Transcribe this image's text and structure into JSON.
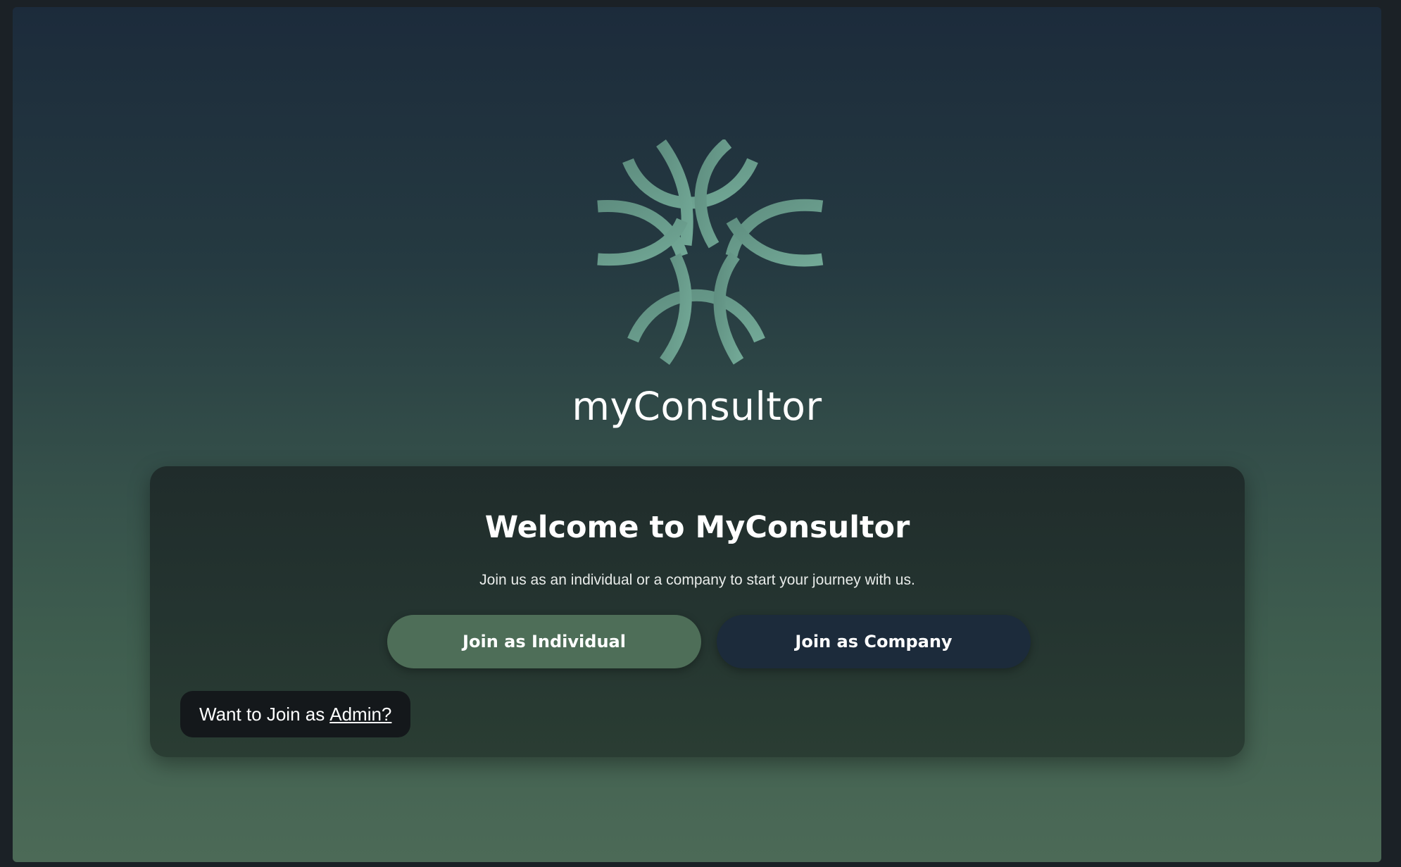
{
  "brand": {
    "name": "myConsultor",
    "logo_icon": "interlocking-arcs-logo-icon",
    "logo_color": "#6a9e8d"
  },
  "welcome_card": {
    "title": "Welcome to MyConsultor",
    "subtitle": "Join us as an individual or a company to start your journey with us.",
    "individual_button_label": "Join as Individual",
    "company_button_label": "Join as Company",
    "admin_prompt_text": "Want to Join as",
    "admin_link_label": "Admin?"
  },
  "colors": {
    "individual_button": "#4e6e58",
    "company_button": "#1c2b3b",
    "admin_pill": "#14181b",
    "background_top": "#1c2b3b",
    "background_bottom": "#4c6a57"
  }
}
